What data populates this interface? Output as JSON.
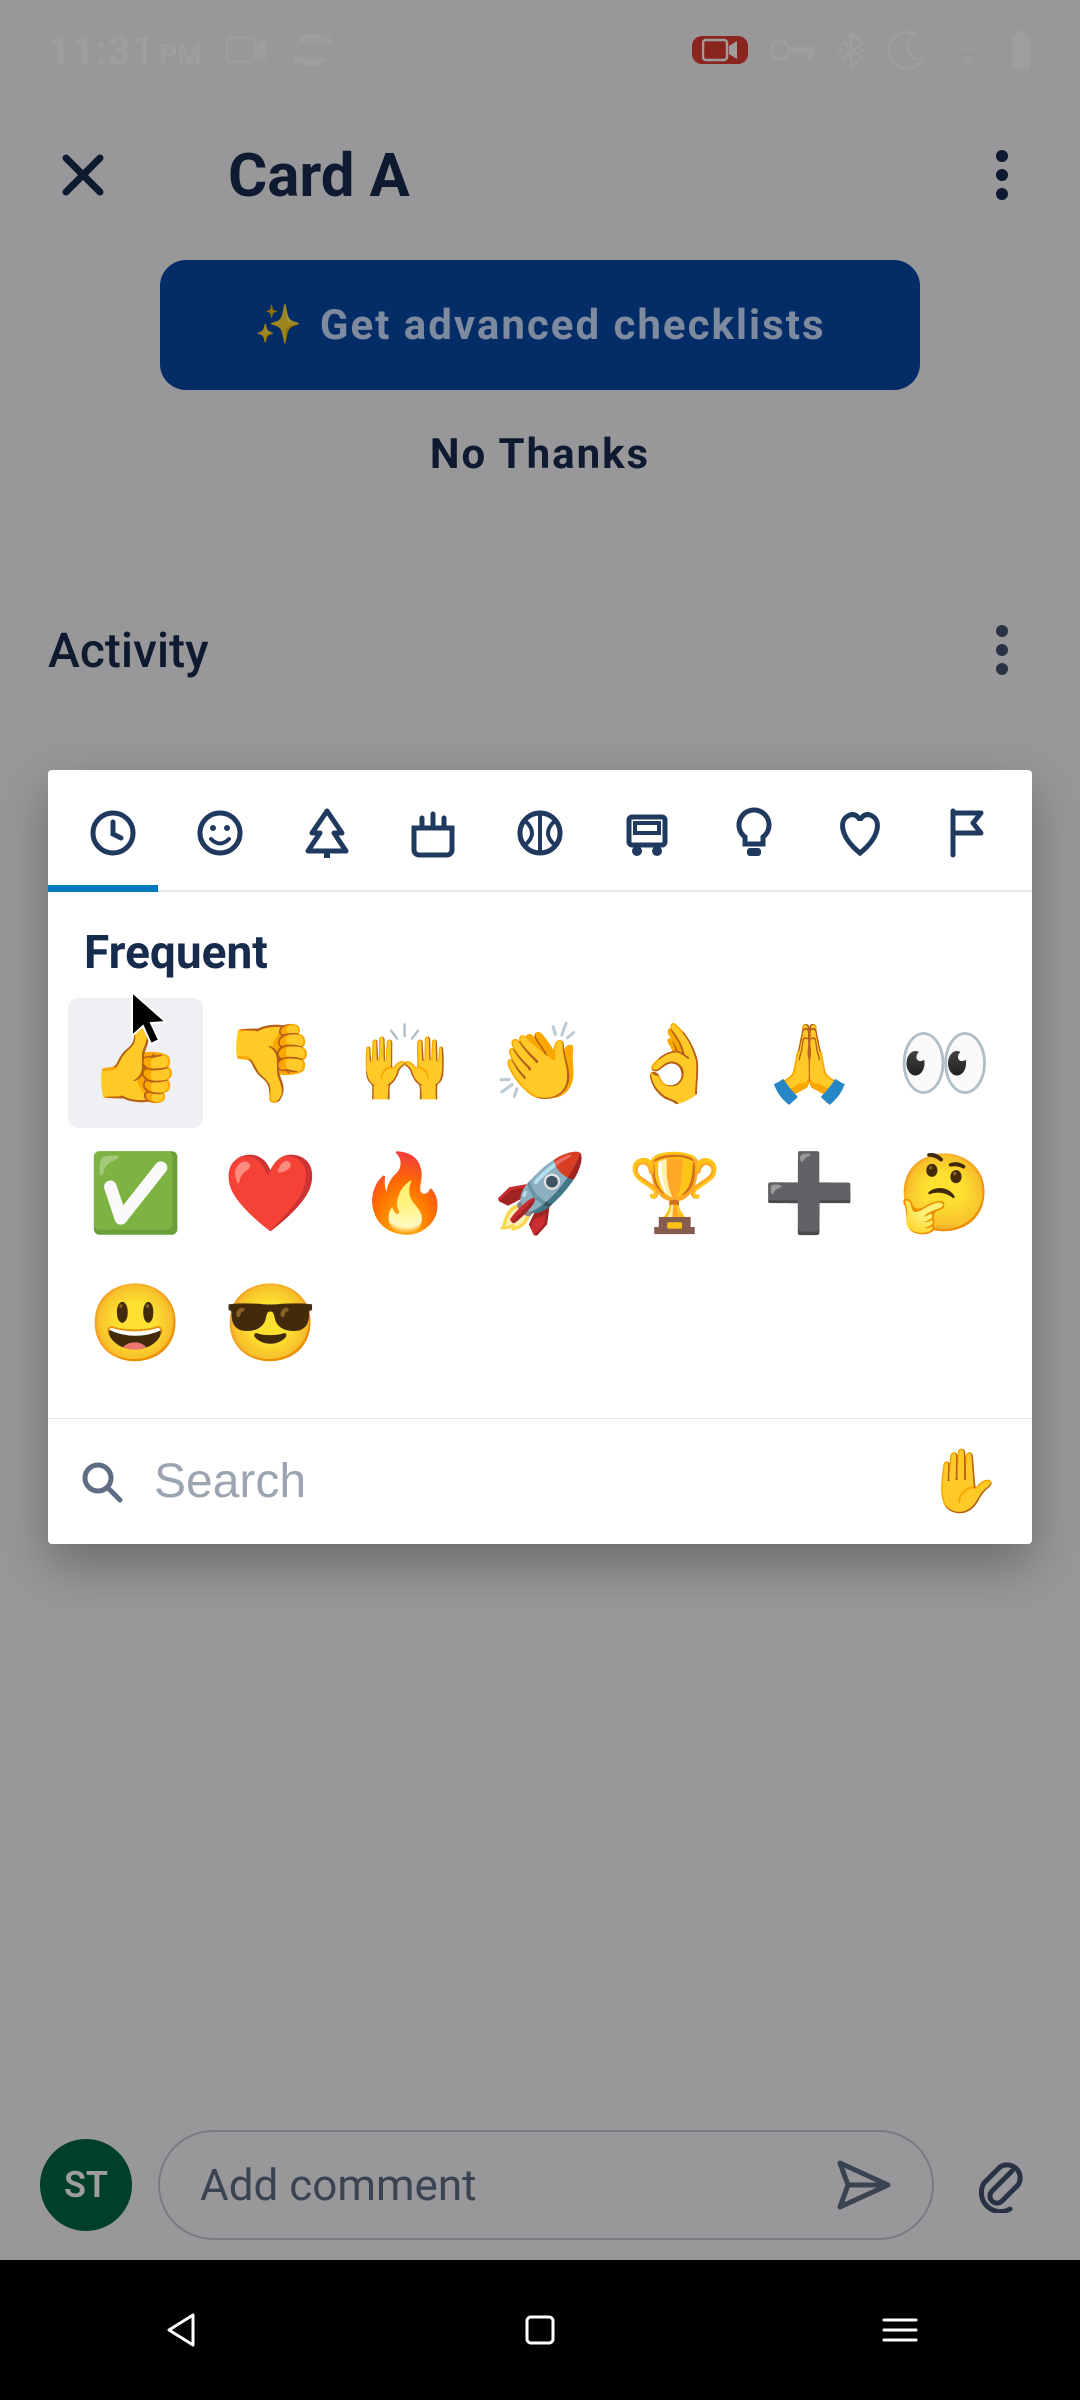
{
  "status": {
    "time": "11:31",
    "ampm": "PM"
  },
  "app_bar": {
    "title": "Card A"
  },
  "promo": {
    "cta": "Get advanced checklists",
    "dismiss": "No Thanks"
  },
  "activity": {
    "label": "Activity"
  },
  "picker": {
    "tabs": [
      "recent",
      "smileys",
      "nature",
      "food",
      "activities",
      "travel",
      "objects",
      "symbols",
      "flags"
    ],
    "section_title": "Frequent",
    "frequent": [
      "👍",
      "👎",
      "🙌",
      "👏",
      "👌",
      "🙏",
      "👀",
      "✅",
      "❤️",
      "🔥",
      "🚀",
      "🏆",
      "➕",
      "🤔",
      "😃",
      "😎"
    ],
    "search_placeholder": "Search",
    "skin_tone": "✋"
  },
  "comment": {
    "avatar_initials": "ST",
    "placeholder": "Add comment"
  }
}
